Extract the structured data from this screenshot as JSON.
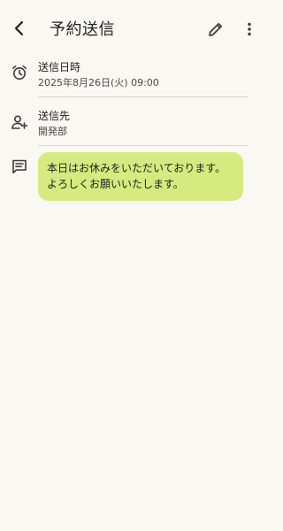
{
  "header": {
    "title": "予約送信",
    "back_icon": "arrow-back-icon",
    "edit_icon": "pencil-icon",
    "more_icon": "more-vert-icon"
  },
  "schedule": {
    "icon": "alarm-clock-icon",
    "label": "送信日時",
    "value": "2025年8月26日(火) 09:00"
  },
  "recipient": {
    "icon": "add-person-icon",
    "label": "送信先",
    "value": "開発部"
  },
  "message": {
    "icon": "message-icon",
    "lines": [
      "本日はお休みをいただいております。",
      "よろしくお願いいたします。"
    ],
    "bubble_color": "#d5ea7f"
  },
  "colors": {
    "background": "#f9f8f2",
    "divider": "#d7d5cc"
  }
}
